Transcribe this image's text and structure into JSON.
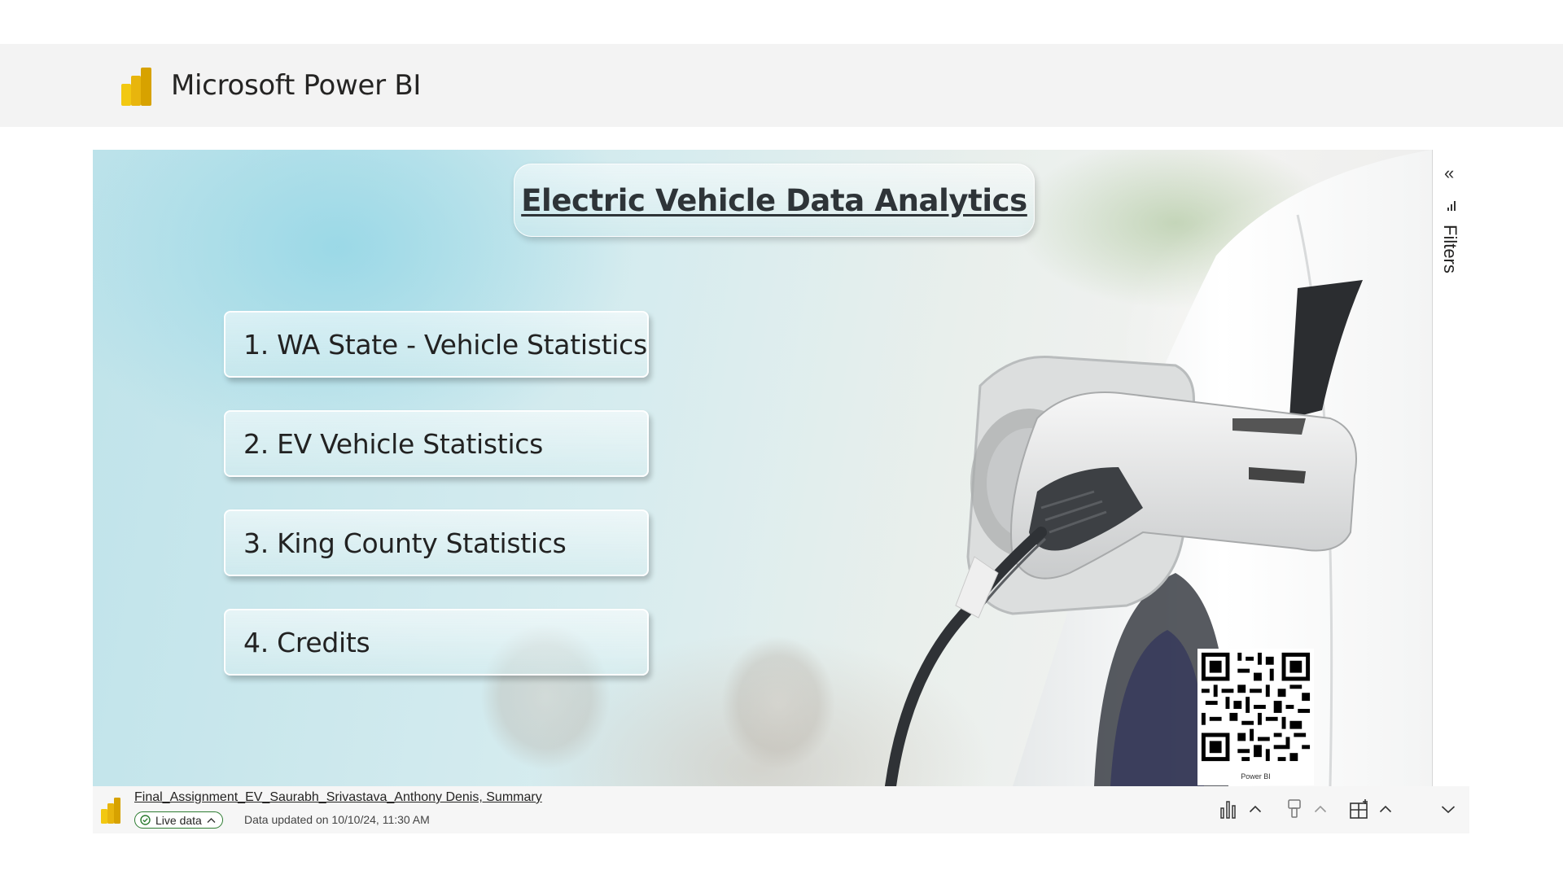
{
  "header": {
    "brand": "Microsoft Power BI",
    "logo_icon": "power-bi-logo"
  },
  "report": {
    "title": "Electric Vehicle Data Analytics",
    "nav_buttons": [
      {
        "label": "1. WA State - Vehicle Statistics"
      },
      {
        "label": "2. EV Vehicle Statistics"
      },
      {
        "label": "3. King County Statistics"
      },
      {
        "label": "4. Credits"
      }
    ],
    "qr_label": "Power BI",
    "background_image": "ev-charger-plugged-into-car"
  },
  "filters_pane": {
    "label": "Filters",
    "collapse_icon": "double-chevron-left-icon",
    "filter_icon": "filter-icon"
  },
  "footer": {
    "report_name": "Final_Assignment_EV_Saurabh_Srivastava_Anthony Denis, Summary",
    "live_label": "Live data",
    "updated_text": "Data updated on 10/10/24, 11:30 AM",
    "tools": [
      "bar-chart-icon",
      "chevron-up-icon",
      "paint-brush-icon",
      "chevron-up-icon",
      "add-table-icon",
      "chevron-up-icon",
      "chevron-down-icon"
    ]
  },
  "colors": {
    "header_bg": "#f3f3f3",
    "live_green": "#2e7d32",
    "logo_yellow": "#f2c811"
  }
}
